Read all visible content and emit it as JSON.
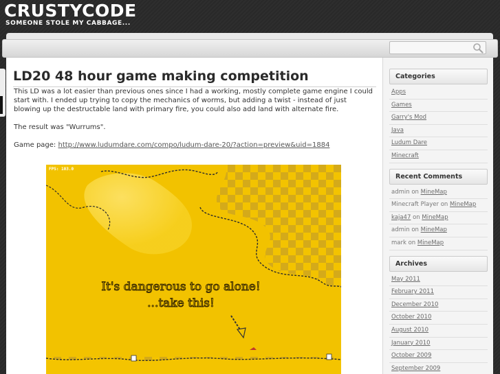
{
  "site": {
    "title": "CRUSTYCODE",
    "tagline": "SOMEONE STOLE MY CABBAGE..."
  },
  "search": {
    "placeholder": "",
    "value": ""
  },
  "post": {
    "title": "LD20 48 hour game making competition",
    "paragraph1": "This LD was a lot easier than previous ones since I had a working, mostly complete game engine I could start with. I ended up trying to copy the mechanics of worms, but adding a twist - instead of just blowing up the destructable land with primary fire, you could also add land with alternate fire.",
    "paragraph2": "The result was \"Wurrums\".",
    "game_page_label": "Game page: ",
    "game_page_link": "http://www.ludumdare.com/compo/ludum-dare-20/?action=preview&uid=1884"
  },
  "screenshot": {
    "fps_text": "FPS: 103.0",
    "line1": "It's dangerous to go alone!",
    "line2": "...take this!"
  },
  "sidebar": {
    "categories": {
      "title": "Categories",
      "items": [
        "Apps",
        "Games",
        "Garry's Mod",
        "Java",
        "Ludum Dare",
        "Minecraft"
      ]
    },
    "recent_comments": {
      "title": "Recent Comments",
      "items": [
        {
          "author": "admin",
          "on": "on",
          "post": "MineMap",
          "author_link": false
        },
        {
          "author": "Minecraft Player",
          "on": "on",
          "post": "MineMap",
          "author_link": false
        },
        {
          "author": "kaja47",
          "on": "on",
          "post": "MineMap",
          "author_link": true
        },
        {
          "author": "admin",
          "on": "on",
          "post": "MineMap",
          "author_link": false
        },
        {
          "author": "mark",
          "on": "on",
          "post": "MineMap",
          "author_link": false
        }
      ]
    },
    "archives": {
      "title": "Archives",
      "items": [
        "May 2011",
        "February 2011",
        "December 2010",
        "October 2010",
        "August 2010",
        "January 2010",
        "October 2009",
        "September 2009"
      ]
    }
  },
  "colors": {
    "background": "#2b2b2b",
    "game_yellow": "#f2c200",
    "link": "#555555"
  }
}
